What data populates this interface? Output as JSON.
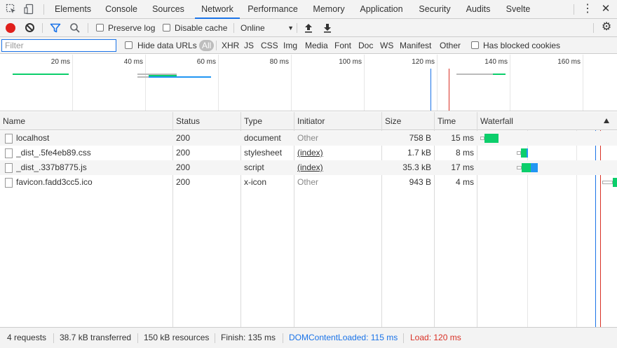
{
  "tabs": [
    "Elements",
    "Console",
    "Sources",
    "Network",
    "Performance",
    "Memory",
    "Application",
    "Security",
    "Audits",
    "Svelte"
  ],
  "active_tab": "Network",
  "toolbar": {
    "preserve_log_label": "Preserve log",
    "disable_cache_label": "Disable cache",
    "throttle_value": "Online"
  },
  "filter": {
    "placeholder": "Filter",
    "hide_data_urls_label": "Hide data URLs",
    "types": [
      "All",
      "XHR",
      "JS",
      "CSS",
      "Img",
      "Media",
      "Font",
      "Doc",
      "WS",
      "Manifest",
      "Other"
    ],
    "blocked_cookies_label": "Has blocked cookies"
  },
  "overview": {
    "ticks": [
      "20 ms",
      "40 ms",
      "60 ms",
      "80 ms",
      "100 ms",
      "120 ms",
      "140 ms",
      "160 ms"
    ]
  },
  "columns": [
    "Name",
    "Status",
    "Type",
    "Initiator",
    "Size",
    "Time",
    "Waterfall"
  ],
  "requests": [
    {
      "name": "localhost",
      "status": "200",
      "type": "document",
      "initiator": "Other",
      "size": "758 B",
      "time": "15 ms"
    },
    {
      "name": "_dist_.5fe4eb89.css",
      "status": "200",
      "type": "stylesheet",
      "initiator": "(index)",
      "size": "1.7 kB",
      "time": "8 ms"
    },
    {
      "name": "_dist_.337b8775.js",
      "status": "200",
      "type": "script",
      "initiator": "(index)",
      "size": "35.3 kB",
      "time": "17 ms"
    },
    {
      "name": "favicon.fadd3cc5.ico",
      "status": "200",
      "type": "x-icon",
      "initiator": "Other",
      "size": "943 B",
      "time": "4 ms"
    }
  ],
  "status_bar": {
    "requests": "4 requests",
    "transferred": "38.7 kB transferred",
    "resources": "150 kB resources",
    "finish": "Finish: 135 ms",
    "dom_content_loaded": "DOMContentLoaded: 115 ms",
    "load": "Load: 120 ms"
  },
  "colors": {
    "accent": "#1a73e8",
    "record": "#e0201c",
    "dcl": "#1a73e8",
    "load": "#d93025",
    "waiting": "#0cce6b",
    "download": "#2196f3"
  }
}
